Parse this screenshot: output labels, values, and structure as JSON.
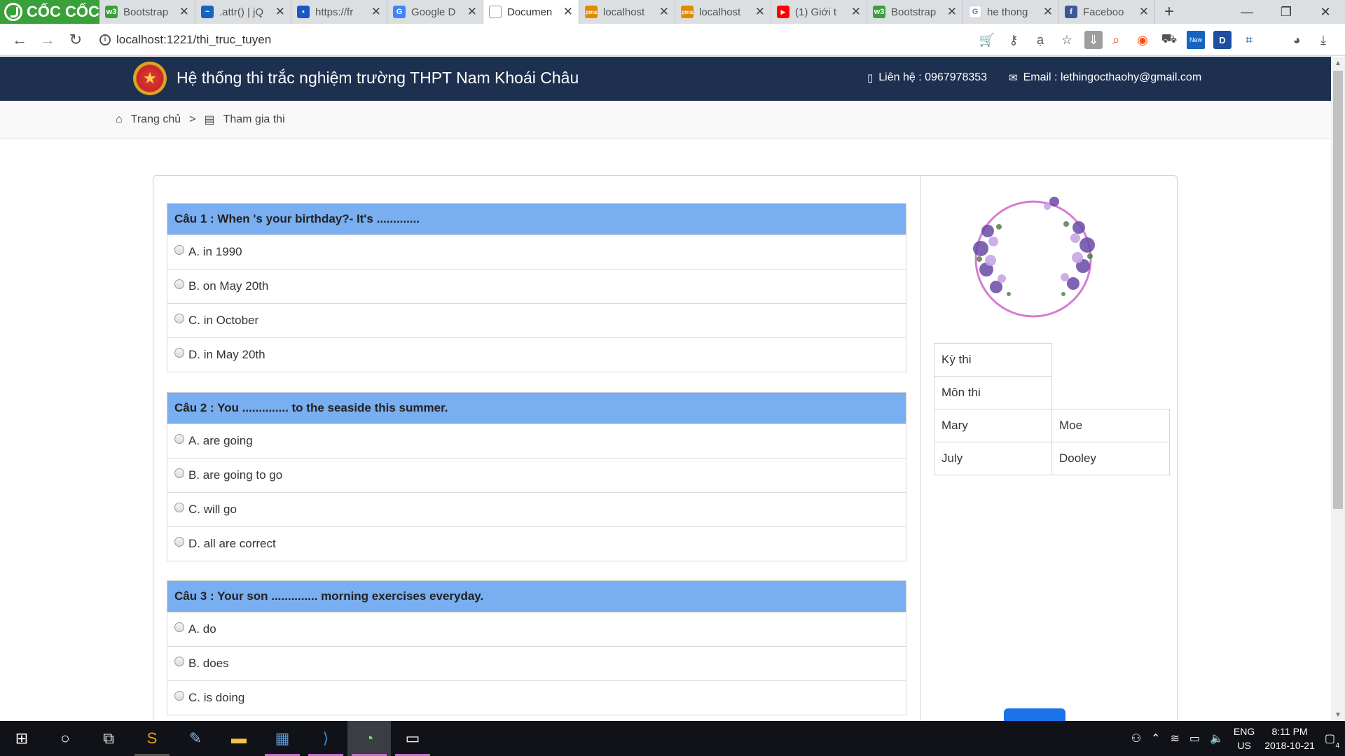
{
  "browser": {
    "brand": "CỐC CỐC",
    "tabs": [
      {
        "label": "Bootstrap",
        "color": "#3aa03a",
        "glyph": "w3"
      },
      {
        "label": ".attr() | jQ",
        "color": "#1565c0",
        "glyph": "~"
      },
      {
        "label": "https://fr",
        "color": "#1a56c4",
        "glyph": "▪"
      },
      {
        "label": "Google D",
        "color": "#4285f4",
        "glyph": "G"
      },
      {
        "label": "Documen",
        "color": "#777777",
        "glyph": "▯",
        "active": true
      },
      {
        "label": "localhost",
        "color": "#e08a00",
        "glyph": "pma"
      },
      {
        "label": "localhost",
        "color": "#e08a00",
        "glyph": "pma"
      },
      {
        "label": "(1) Giới t",
        "color": "#ff0000",
        "glyph": "▶"
      },
      {
        "label": "Bootstrap",
        "color": "#3aa03a",
        "glyph": "w3"
      },
      {
        "label": "he thong",
        "color": "#4285f4",
        "glyph": "G"
      },
      {
        "label": "Faceboo",
        "color": "#3b5998",
        "glyph": "f"
      }
    ],
    "url": "localhost:1221/thi_truc_tuyen",
    "ext_new_badge": "New",
    "ext_d_badge": "D"
  },
  "header": {
    "title": "Hệ thống thi trắc nghiệm trường THPT Nam Khoái Châu",
    "contact": "Liên hệ : 0967978353",
    "email": "Email : lethingocthaohy@gmail.com"
  },
  "breadcrumb": {
    "home": "Trang chủ",
    "separator": ">",
    "current": "Tham gia thi"
  },
  "questions": [
    {
      "title": "Câu 1 : When 's your birthday?- It's .............",
      "options": [
        "A. in 1990",
        "B. on May 20th",
        "C. in October",
        "D. in May 20th"
      ]
    },
    {
      "title": "Câu 2 : You .............. to the seaside this summer.",
      "options": [
        "A. are going",
        "B. are going to go",
        "C. will go",
        "D. all are correct"
      ]
    },
    {
      "title": "Câu 3 : Your son .............. morning exercises everyday.",
      "options": [
        "A. do",
        "B. does",
        "C. is doing"
      ]
    }
  ],
  "info_table": {
    "exam_label": "Kỳ thi",
    "subject_label": "Môn thi",
    "rows": [
      [
        "Mary",
        "Moe"
      ],
      [
        "July",
        "Dooley"
      ]
    ]
  },
  "taskbar": {
    "lang": "ENG",
    "region": "US",
    "time": "8:11 PM",
    "date": "2018-10-21",
    "notifications": "4"
  },
  "colors": {
    "header_bg": "#1e3050",
    "question_header": "#79aef0",
    "brand_green": "#3aa03a"
  }
}
